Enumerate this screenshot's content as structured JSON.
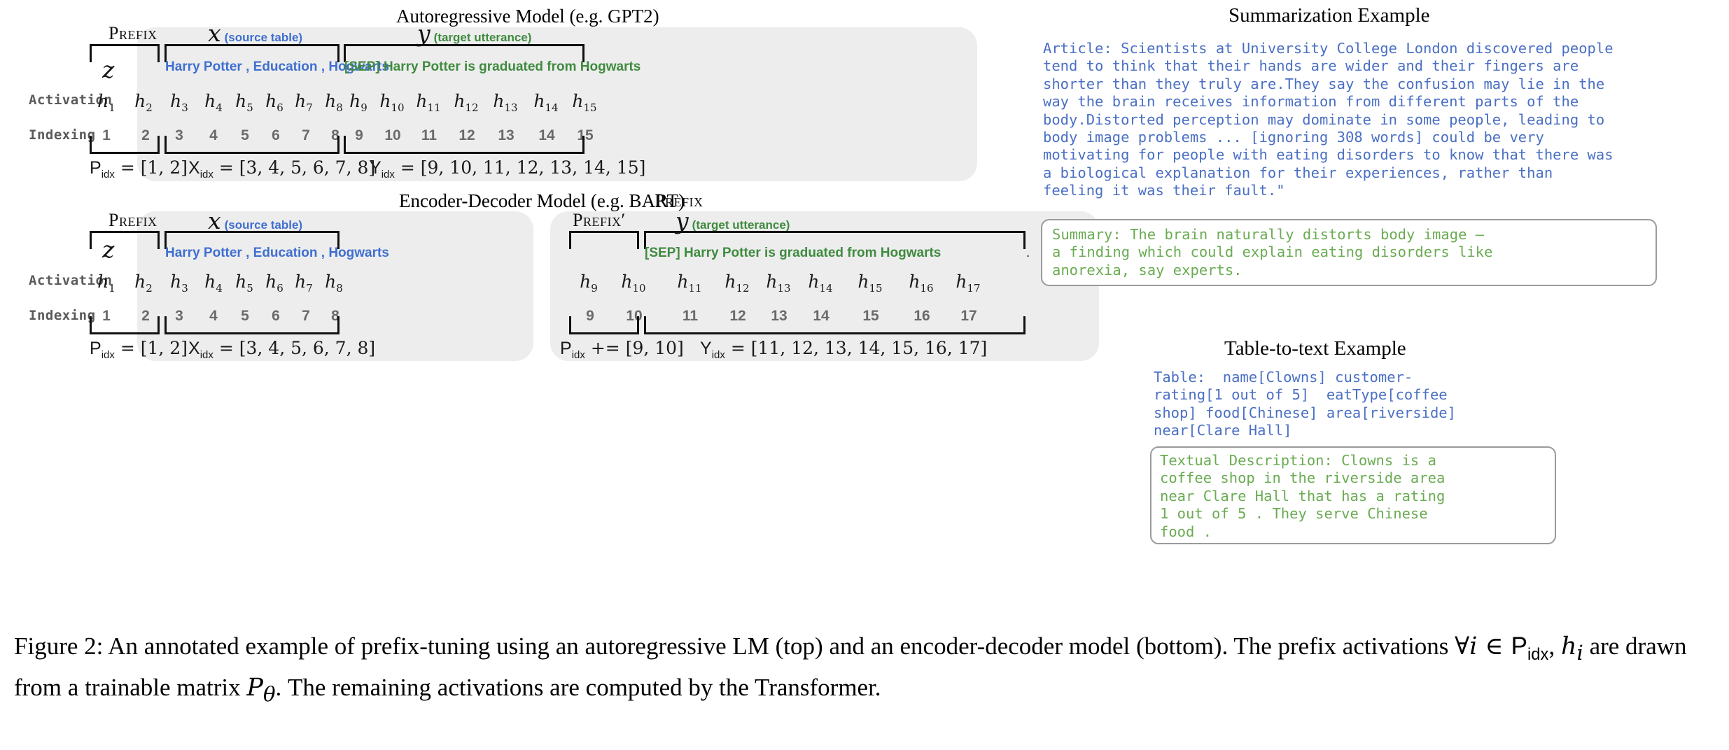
{
  "figure": {
    "caption_prefix": "Figure 2:",
    "caption_part1": "  An annotated example of prefix-tuning using an autoregressive LM (top) and an encoder-decoder model (bottom). The prefix activations ",
    "caption_math1": "∀i ∈ ",
    "caption_math_pidx": "P",
    "caption_math_pidx_sub": "idx",
    "caption_math2": ", ",
    "caption_math_h": "h",
    "caption_math_h_sub": "i",
    "caption_part2": " are drawn from a trainable matrix ",
    "caption_math_p": "P",
    "caption_math_p_sub": "θ",
    "caption_part3": ". The remaining activations are computed by the Transformer."
  },
  "top_diagram": {
    "title": "Autoregressive Model  (e.g. GPT2)",
    "row_labels": {
      "z": "z",
      "activation": "Activation",
      "indexing": "Indexing"
    },
    "segments": [
      {
        "name": "prefix",
        "label": "Prefix",
        "label_kind": "smallcaps",
        "tokens": "",
        "token_color": "none",
        "activations": [
          "h1",
          "h2"
        ],
        "indices": [
          "1",
          "2"
        ],
        "formula_var": "P",
        "formula_sub": "idx",
        "formula_op": "=",
        "formula_value": "[1, 2]"
      },
      {
        "name": "source",
        "label": "x",
        "label_kind": "math",
        "label_tag": "(source table)",
        "label_tag_color": "blue",
        "tokens": "Harry  Potter , Education ,  Hogwarts",
        "token_color": "blue",
        "activations": [
          "h3",
          "h4",
          "h5",
          "h6",
          "h7",
          "h8"
        ],
        "indices": [
          "3",
          "4",
          "5",
          "6",
          "7",
          "8"
        ],
        "formula_var": "X",
        "formula_sub": "idx",
        "formula_op": "=",
        "formula_value": "[3, 4, 5, 6, 7, 8]"
      },
      {
        "name": "target",
        "label": "y",
        "label_kind": "math",
        "label_tag": "(target utterance)",
        "label_tag_color": "green",
        "tokens": "[SEP]  Harry  Potter   is  graduated  from  Hogwarts",
        "tokens_tail": ".",
        "token_color": "green",
        "activations": [
          "h9",
          "h10",
          "h11",
          "h12",
          "h13",
          "h14",
          "h15"
        ],
        "indices": [
          "9",
          "10",
          "11",
          "12",
          "13",
          "14",
          "15"
        ],
        "formula_var": "Y",
        "formula_sub": "idx",
        "formula_op": "=",
        "formula_value": "[9, 10, 11, 12, 13, 14, 15]"
      }
    ]
  },
  "bottom_diagram": {
    "title": "Encoder-Decoder Model  (e.g. BART)",
    "title2": "Prefix",
    "row_labels": {
      "z": "z",
      "activation": "Activation",
      "indexing": "Indexing"
    },
    "segments": [
      {
        "name": "prefix",
        "label": "Prefix",
        "label_kind": "smallcaps",
        "tokens": "",
        "token_color": "none",
        "activations": [
          "h1",
          "h2"
        ],
        "indices": [
          "1",
          "2"
        ],
        "formula_var": "P",
        "formula_sub": "idx",
        "formula_op": "=",
        "formula_value": "[1, 2]"
      },
      {
        "name": "source",
        "label": "x",
        "label_kind": "math",
        "label_tag": "(source table)",
        "label_tag_color": "blue",
        "tokens": "Harry  Potter , Education ,  Hogwarts",
        "token_color": "blue",
        "activations": [
          "h3",
          "h4",
          "h5",
          "h6",
          "h7",
          "h8"
        ],
        "indices": [
          "3",
          "4",
          "5",
          "6",
          "7",
          "8"
        ],
        "formula_var": "X",
        "formula_sub": "idx",
        "formula_op": "=",
        "formula_value": "[3, 4, 5, 6, 7, 8]"
      },
      {
        "name": "prefix-prime",
        "label": "Prefix′",
        "label_kind": "smallcaps-prime",
        "tokens": "",
        "token_color": "none",
        "activations": [
          "h9",
          "h10"
        ],
        "indices": [
          "9",
          "10"
        ],
        "formula_var": "P",
        "formula_sub": "idx",
        "formula_op": "+=",
        "formula_value": "[9, 10]"
      },
      {
        "name": "target",
        "label": "y",
        "label_kind": "math",
        "label_tag": "(target utterance)",
        "label_tag_color": "green",
        "tokens": "[SEP]  Harry  Potter  is  graduated  from  Hogwarts",
        "tokens_tail": ".",
        "token_color": "green",
        "activations": [
          "h11",
          "h12",
          "h13",
          "h14",
          "h15",
          "h16",
          "h17"
        ],
        "indices": [
          "11",
          "12",
          "13",
          "14",
          "15",
          "16",
          "17"
        ],
        "formula_var": "Y",
        "formula_sub": "idx",
        "formula_op": "=",
        "formula_value": "[11, 12, 13, 14, 15, 16, 17]"
      }
    ]
  },
  "summarization_example": {
    "title": "Summarization Example",
    "article": "Article: Scientists at University College London discovered people\ntend to think that their hands are wider and their fingers are\nshorter than they truly are.They say the confusion may lie in the\nway the brain receives information from different parts of the\nbody.Distorted perception may dominate in some people, leading to\nbody image problems ... [ignoring 308 words] could be very\nmotivating for people with eating disorders to know that there was\na biological explanation for their experiences, rather than\nfeeling it was their fault.\"",
    "summary": "Summary: The brain naturally distorts body image –\na finding which could explain eating disorders like\nanorexia, say experts."
  },
  "table_to_text_example": {
    "title": "Table-to-text Example",
    "table": "Table:  name[Clowns] customer-\nrating[1 out of 5]  eatType[coffee\nshop] food[Chinese] area[riverside]\nnear[Clare Hall]",
    "description": "Textual Description: Clowns is a\ncoffee shop in the riverside area\nnear Clare Hall that has a rating\n1 out of 5 . They serve Chinese\nfood ."
  },
  "colors": {
    "source_blue": "#3f6fd0",
    "target_green": "#3f8b3f",
    "mono_blue": "#4a6fc4",
    "mono_green": "#6aab52",
    "panel_bg": "#ededed",
    "box_border": "#9a9a9a"
  }
}
